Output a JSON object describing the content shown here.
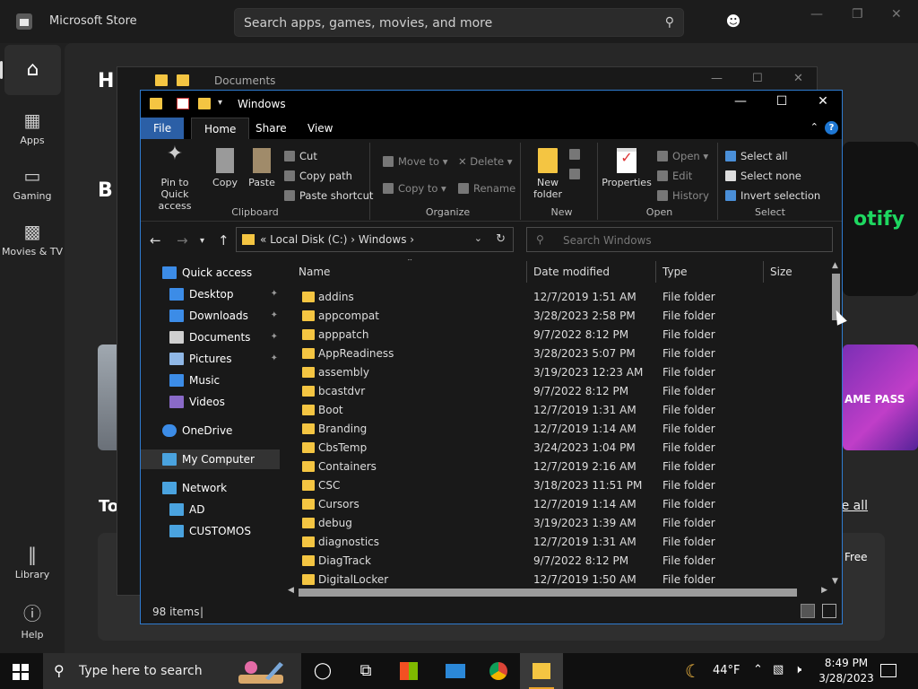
{
  "store": {
    "title": "Microsoft Store",
    "search_placeholder": "Search apps, games, movies, and more",
    "nav": [
      {
        "label": "Apps",
        "icon": "apps-icon"
      },
      {
        "label": "Gaming",
        "icon": "gamepad-icon"
      },
      {
        "label": "Movies & TV",
        "icon": "film-icon"
      },
      {
        "label": "Library",
        "icon": "library-icon"
      },
      {
        "label": "Help",
        "icon": "help-icon"
      }
    ],
    "hero_fragment": "H",
    "hero_fragment2": "B",
    "spotify_text": "otify",
    "gamepass_text": "AME PASS",
    "section_fragment": "To",
    "see_all": "ee all",
    "free_label": "Free"
  },
  "docs_window": {
    "title": "Documents"
  },
  "explorer": {
    "title": "Windows",
    "tabs": {
      "file": "File",
      "home": "Home",
      "share": "Share",
      "view": "View"
    },
    "ribbon": {
      "clipboard": {
        "label": "Clipboard",
        "pin": "Pin to Quick access",
        "copy": "Copy",
        "paste": "Paste",
        "cut": "Cut",
        "copy_path": "Copy path",
        "paste_shortcut": "Paste shortcut"
      },
      "organize": {
        "label": "Organize",
        "move_to": "Move to",
        "copy_to": "Copy to",
        "delete": "Delete",
        "rename": "Rename"
      },
      "new": {
        "label": "New",
        "new_folder": "New folder"
      },
      "open": {
        "label": "Open",
        "properties": "Properties",
        "open": "Open",
        "edit": "Edit",
        "history": "History"
      },
      "select": {
        "label": "Select",
        "select_all": "Select all",
        "select_none": "Select none",
        "invert": "Invert selection"
      }
    },
    "address": {
      "path": "«  Local Disk (C:)  ›  Windows  ›"
    },
    "search_placeholder": "Search Windows",
    "nav_pane": [
      {
        "label": "Quick access",
        "icon": "star-icon",
        "indent": 0,
        "pinned": false
      },
      {
        "label": "Desktop",
        "icon": "desktop-icon",
        "indent": 1,
        "pinned": true
      },
      {
        "label": "Downloads",
        "icon": "download-icon",
        "indent": 1,
        "pinned": true
      },
      {
        "label": "Documents",
        "icon": "document-icon",
        "indent": 1,
        "pinned": true
      },
      {
        "label": "Pictures",
        "icon": "picture-icon",
        "indent": 1,
        "pinned": true
      },
      {
        "label": "Music",
        "icon": "music-icon",
        "indent": 1,
        "pinned": false
      },
      {
        "label": "Videos",
        "icon": "video-icon",
        "indent": 1,
        "pinned": false
      },
      {
        "label": "OneDrive",
        "icon": "cloud-icon",
        "indent": 0,
        "pinned": false
      },
      {
        "label": "My Computer",
        "icon": "computer-icon",
        "indent": 0,
        "pinned": false
      },
      {
        "label": "Network",
        "icon": "network-icon",
        "indent": 0,
        "pinned": false
      },
      {
        "label": "AD",
        "icon": "computer-icon",
        "indent": 1,
        "pinned": false
      },
      {
        "label": "CUSTOMOS",
        "icon": "computer-icon",
        "indent": 1,
        "pinned": false
      }
    ],
    "columns": {
      "name": "Name",
      "date": "Date modified",
      "type": "Type",
      "size": "Size"
    },
    "files": [
      {
        "name": "addins",
        "date": "12/7/2019 1:51 AM",
        "type": "File folder"
      },
      {
        "name": "appcompat",
        "date": "3/28/2023 2:58 PM",
        "type": "File folder"
      },
      {
        "name": "apppatch",
        "date": "9/7/2022 8:12 PM",
        "type": "File folder"
      },
      {
        "name": "AppReadiness",
        "date": "3/28/2023 5:07 PM",
        "type": "File folder"
      },
      {
        "name": "assembly",
        "date": "3/19/2023 12:23 AM",
        "type": "File folder"
      },
      {
        "name": "bcastdvr",
        "date": "9/7/2022 8:12 PM",
        "type": "File folder"
      },
      {
        "name": "Boot",
        "date": "12/7/2019 1:31 AM",
        "type": "File folder"
      },
      {
        "name": "Branding",
        "date": "12/7/2019 1:14 AM",
        "type": "File folder"
      },
      {
        "name": "CbsTemp",
        "date": "3/24/2023 1:04 PM",
        "type": "File folder"
      },
      {
        "name": "Containers",
        "date": "12/7/2019 2:16 AM",
        "type": "File folder"
      },
      {
        "name": "CSC",
        "date": "3/18/2023 11:51 PM",
        "type": "File folder"
      },
      {
        "name": "Cursors",
        "date": "12/7/2019 1:14 AM",
        "type": "File folder"
      },
      {
        "name": "debug",
        "date": "3/19/2023 1:39 AM",
        "type": "File folder"
      },
      {
        "name": "diagnostics",
        "date": "12/7/2019 1:31 AM",
        "type": "File folder"
      },
      {
        "name": "DiagTrack",
        "date": "9/7/2022 8:12 PM",
        "type": "File folder"
      },
      {
        "name": "DigitalLocker",
        "date": "12/7/2019 1:50 AM",
        "type": "File folder"
      }
    ],
    "status": {
      "count": "98 items",
      "sep": "|"
    }
  },
  "taskbar": {
    "search_placeholder": "Type here to search",
    "temperature": "44°F",
    "time": "8:49 PM",
    "date": "3/28/2023"
  }
}
